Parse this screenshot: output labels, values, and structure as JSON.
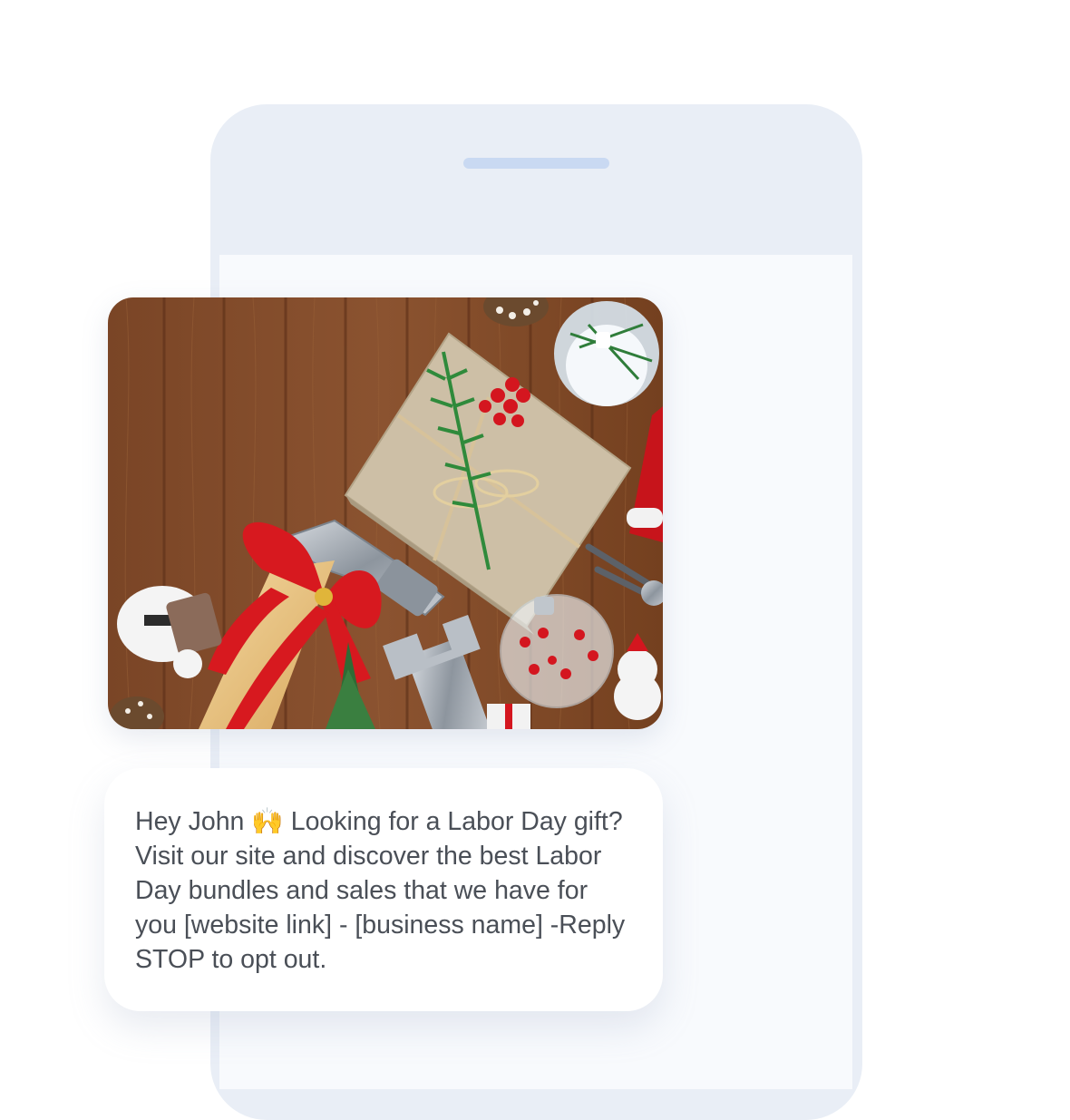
{
  "message": {
    "text": "Hey John 🙌 Looking for a Labor Day gift? Visit our site and discover the best Labor Day bundles and sales that we have for you [website link] - [business name] -Reply STOP to opt out."
  },
  "image": {
    "subject": "holiday-gift-tools-photo"
  },
  "colors": {
    "phone_frame": "#e9eef6",
    "phone_screen": "#f8fafd",
    "speaker": "#c9d9f2",
    "bubble": "#ffffff",
    "text": "#4a4f57"
  }
}
